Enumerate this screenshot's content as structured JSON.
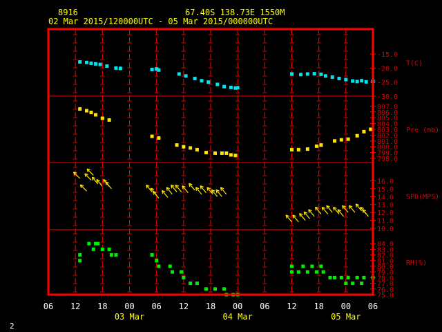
{
  "header": {
    "station": "8916",
    "location": "67.40S  138.73E  1550M",
    "period": "02 Mar 2015/120000UTC - 05 Mar 2015/000000UTC"
  },
  "x_axis": {
    "hour_labels": [
      "06",
      "12",
      "18",
      "00",
      "06",
      "12",
      "18",
      "00",
      "06",
      "12",
      "18",
      "00",
      "06"
    ],
    "date_labels": [
      "03 Mar",
      "04 Mar",
      "05 Mar"
    ]
  },
  "page_number": "2",
  "colors": {
    "frame": "#ff0000",
    "temperature": "#00e5ee",
    "pressure": "#ffe600",
    "wind": "#ffe600",
    "humidity": "#00ee00"
  },
  "chart_data": {
    "type": "scatter",
    "x_unit": "hours since 02 Mar 2015 00 UTC",
    "xlim": [
      6,
      78
    ],
    "panels": [
      {
        "name": "T(C)",
        "ticks": [
          "-15.0",
          "-20.0",
          "-25.0",
          "-30.0"
        ],
        "ylim": [
          -30,
          -12
        ],
        "points": [
          [
            13.0,
            -17.8
          ],
          [
            14.5,
            -18.0
          ],
          [
            15.5,
            -18.3
          ],
          [
            16.5,
            -18.5
          ],
          [
            17.5,
            -18.7
          ],
          [
            19.0,
            -19.3
          ],
          [
            21.0,
            -20.0
          ],
          [
            22.0,
            -20.1
          ],
          [
            29.0,
            -20.5
          ],
          [
            30.0,
            -20.3
          ],
          [
            30.5,
            -20.7
          ],
          [
            35.0,
            -22.1
          ],
          [
            36.5,
            -22.8
          ],
          [
            38.5,
            -23.7
          ],
          [
            40.0,
            -24.5
          ],
          [
            41.5,
            -25.0
          ],
          [
            43.5,
            -25.8
          ],
          [
            45.0,
            -26.6
          ],
          [
            46.5,
            -26.9
          ],
          [
            47.5,
            -27.1
          ],
          [
            48.0,
            -27.0
          ],
          [
            60.0,
            -22.1
          ],
          [
            62.0,
            -22.3
          ],
          [
            63.5,
            -22.1
          ],
          [
            65.0,
            -22.0
          ],
          [
            66.5,
            -22.2
          ],
          [
            67.5,
            -22.8
          ],
          [
            69.0,
            -23.2
          ],
          [
            70.5,
            -23.7
          ],
          [
            72.0,
            -24.1
          ],
          [
            73.5,
            -24.6
          ],
          [
            74.5,
            -24.8
          ],
          [
            75.5,
            -24.5
          ],
          [
            76.5,
            -24.9
          ],
          [
            78.0,
            -24.7
          ]
        ]
      },
      {
        "name": "Pre (mb)",
        "ticks": [
          "807.0",
          "806.0",
          "805.0",
          "804.0",
          "803.0",
          "802.0",
          "801.0",
          "800.0",
          "799.0",
          "798.0"
        ],
        "ylim": [
          798,
          807.4
        ],
        "points": [
          [
            13.0,
            806.5
          ],
          [
            14.5,
            806.2
          ],
          [
            15.5,
            805.9
          ],
          [
            16.5,
            805.5
          ],
          [
            18.0,
            804.9
          ],
          [
            19.5,
            804.6
          ],
          [
            29.0,
            801.8
          ],
          [
            30.5,
            801.5
          ],
          [
            34.5,
            800.3
          ],
          [
            36.0,
            800.0
          ],
          [
            37.5,
            799.8
          ],
          [
            39.0,
            799.5
          ],
          [
            41.0,
            799.0
          ],
          [
            43.0,
            798.9
          ],
          [
            44.5,
            798.9
          ],
          [
            45.5,
            798.9
          ],
          [
            46.5,
            798.6
          ],
          [
            47.5,
            798.5
          ],
          [
            60.0,
            799.5
          ],
          [
            61.5,
            799.5
          ],
          [
            63.5,
            799.6
          ],
          [
            65.5,
            800.1
          ],
          [
            66.5,
            800.3
          ],
          [
            69.5,
            801.0
          ],
          [
            71.0,
            801.2
          ],
          [
            72.5,
            801.3
          ],
          [
            74.5,
            801.9
          ],
          [
            76.0,
            802.6
          ],
          [
            77.5,
            803.0
          ]
        ]
      },
      {
        "name": "SPD(MPS)",
        "ticks": [
          "16.0",
          "15.0",
          "14.0",
          "13.0",
          "12.0",
          "11.0",
          "10.0"
        ],
        "ylim": [
          10,
          17
        ],
        "arrows": [
          [
            13.0,
            16.3,
            315
          ],
          [
            14.5,
            14.7,
            315
          ],
          [
            15.5,
            16.1,
            315
          ],
          [
            16.0,
            16.7,
            315
          ],
          [
            17.0,
            15.6,
            320
          ],
          [
            18.0,
            15.3,
            320
          ],
          [
            19.5,
            15.3,
            320
          ],
          [
            20.0,
            15.0,
            320
          ],
          [
            29.0,
            14.6,
            320
          ],
          [
            30.0,
            14.2,
            320
          ],
          [
            30.5,
            13.8,
            320
          ],
          [
            32.5,
            13.9,
            320
          ],
          [
            33.5,
            14.3,
            320
          ],
          [
            34.5,
            14.6,
            320
          ],
          [
            35.5,
            14.6,
            320
          ],
          [
            37.0,
            14.5,
            320
          ],
          [
            38.5,
            14.8,
            320
          ],
          [
            40.0,
            14.3,
            320
          ],
          [
            41.0,
            14.5,
            320
          ],
          [
            42.5,
            14.3,
            320
          ],
          [
            43.5,
            14.0,
            320
          ],
          [
            44.5,
            14.0,
            320
          ],
          [
            45.5,
            14.3,
            320
          ],
          [
            60.0,
            10.8,
            320
          ],
          [
            61.5,
            10.8,
            320
          ],
          [
            63.0,
            11.0,
            320
          ],
          [
            64.0,
            11.2,
            320
          ],
          [
            65.0,
            11.5,
            320
          ],
          [
            66.5,
            11.8,
            320
          ],
          [
            68.0,
            11.8,
            320
          ],
          [
            69.0,
            12.0,
            320
          ],
          [
            70.5,
            11.8,
            320
          ],
          [
            71.5,
            11.5,
            320
          ],
          [
            72.5,
            12.0,
            320
          ],
          [
            74.0,
            12.0,
            320
          ],
          [
            75.5,
            12.2,
            320
          ],
          [
            76.5,
            11.8,
            320
          ],
          [
            77.0,
            11.5,
            320
          ]
        ]
      },
      {
        "name": "RH(%)",
        "ticks": [
          "84.0",
          "83.0",
          "82.0",
          "81.0",
          "80.0",
          "79.0",
          "78.0",
          "77.0",
          "76.0",
          "75.0"
        ],
        "ylim": [
          75,
          85
        ],
        "points": [
          [
            13.0,
            82.0
          ],
          [
            13.0,
            81.0
          ],
          [
            15.0,
            84.0
          ],
          [
            16.0,
            83.0
          ],
          [
            16.5,
            84.0
          ],
          [
            17.0,
            84.0
          ],
          [
            18.0,
            83.0
          ],
          [
            19.5,
            83.0
          ],
          [
            20.0,
            82.0
          ],
          [
            21.0,
            82.0
          ],
          [
            29.0,
            82.0
          ],
          [
            30.0,
            81.0
          ],
          [
            30.5,
            80.0
          ],
          [
            33.0,
            80.0
          ],
          [
            33.5,
            79.0
          ],
          [
            35.5,
            79.0
          ],
          [
            36.0,
            78.0
          ],
          [
            37.5,
            77.0
          ],
          [
            39.0,
            77.0
          ],
          [
            41.0,
            76.0
          ],
          [
            43.0,
            76.0
          ],
          [
            45.0,
            76.0
          ],
          [
            45.5,
            75.0
          ],
          [
            47.0,
            75.0
          ],
          [
            48.0,
            75.0
          ],
          [
            60.0,
            80.0
          ],
          [
            60.0,
            79.0
          ],
          [
            61.5,
            79.0
          ],
          [
            62.5,
            80.0
          ],
          [
            63.5,
            79.0
          ],
          [
            64.5,
            80.0
          ],
          [
            65.5,
            79.0
          ],
          [
            66.5,
            80.0
          ],
          [
            67.0,
            79.0
          ],
          [
            68.5,
            78.0
          ],
          [
            69.5,
            78.0
          ],
          [
            71.0,
            78.0
          ],
          [
            72.0,
            77.0
          ],
          [
            72.5,
            78.0
          ],
          [
            73.5,
            77.0
          ],
          [
            74.5,
            78.0
          ],
          [
            75.5,
            77.0
          ],
          [
            76.0,
            78.0
          ],
          [
            78.0,
            78.0
          ]
        ]
      }
    ]
  }
}
